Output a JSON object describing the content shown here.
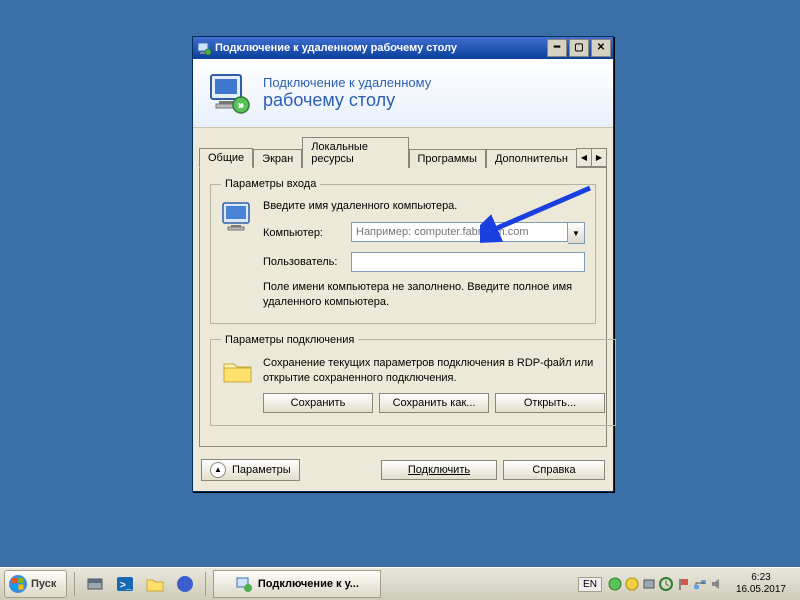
{
  "window": {
    "title": "Подключение к удаленному рабочему столу",
    "banner_line1": "Подключение к удаленному",
    "banner_line2": "рабочему столу",
    "tabs": {
      "general": "Общие",
      "display": "Экран",
      "local": "Локальные ресурсы",
      "programs": "Программы",
      "additional": "Дополнительн"
    },
    "login_group": {
      "legend": "Параметры входа",
      "instruction": "Введите имя удаленного компьютера.",
      "computer_label": "Компьютер:",
      "computer_placeholder": "Например: computer.fabrikam.com",
      "user_label": "Пользователь:",
      "hint": "Поле имени компьютера не заполнено. Введите полное имя удаленного компьютера."
    },
    "connection_group": {
      "legend": "Параметры подключения",
      "text": "Сохранение текущих параметров подключения в RDP-файл или открытие сохраненного подключения.",
      "save": "Сохранить",
      "save_as": "Сохранить как...",
      "open": "Открыть..."
    },
    "footer": {
      "params": "Параметры",
      "connect": "Подключить",
      "help": "Справка"
    }
  },
  "taskbar": {
    "start": "Пуск",
    "task_button": "Подключение к у...",
    "lang": "EN",
    "time": "6:23",
    "date": "16.05.2017"
  }
}
